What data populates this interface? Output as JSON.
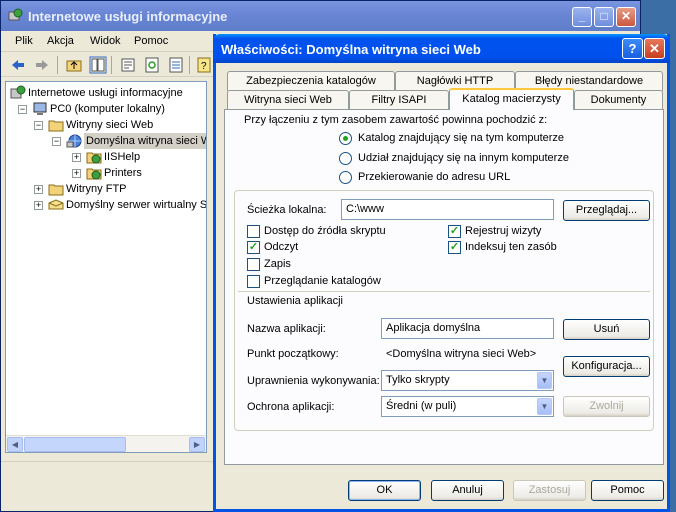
{
  "iis": {
    "title": "Internetowe usługi informacyjne",
    "menu": [
      "Plik",
      "Akcja",
      "Widok",
      "Pomoc"
    ],
    "tree": {
      "root": "Internetowe usługi informacyjne",
      "computer": "PC0 (komputer lokalny)",
      "web_sites": "Witryny sieci Web",
      "default_site": "Domyślna witryna sieci Web",
      "iishelp": "IISHelp",
      "printers": "Printers",
      "ftp_sites": "Witryny FTP",
      "smtp": "Domyślny serwer wirtualny SMTP"
    }
  },
  "dialog": {
    "title": "Właściwości: Domyślna witryna sieci Web",
    "tabs_back": [
      "Zabezpieczenia katalogów",
      "Nagłówki HTTP",
      "Błędy niestandardowe"
    ],
    "tabs_front": [
      "Witryna sieci Web",
      "Filtry ISAPI",
      "Katalog macierzysty",
      "Dokumenty"
    ],
    "active_tab": "Katalog macierzysty",
    "source_prompt": "Przy łączeniu z tym zasobem zawartość powinna pochodzić z:",
    "source_options": [
      {
        "label": "Katalog znajdujący się na tym komputerze",
        "selected": true
      },
      {
        "label": "Udział znajdujący się na innym komputerze",
        "selected": false
      },
      {
        "label": "Przekierowanie do adresu URL",
        "selected": false
      }
    ],
    "local_path_label": "Ścieżka lokalna:",
    "local_path_value": "C:\\www",
    "browse_button": "Przeglądaj...",
    "permissions": {
      "script_source": {
        "label": "Dostęp do źródła skryptu",
        "checked": false
      },
      "read": {
        "label": "Odczyt",
        "checked": true
      },
      "write": {
        "label": "Zapis",
        "checked": false
      },
      "browse": {
        "label": "Przeglądanie katalogów",
        "checked": false
      },
      "log_visits": {
        "label": "Rejestruj wizyty",
        "checked": true
      },
      "index": {
        "label": "Indeksuj ten zasób",
        "checked": true
      }
    },
    "app_settings_heading": "Ustawienia aplikacji",
    "app_name_label": "Nazwa aplikacji:",
    "app_name_value": "Aplikacja domyślna",
    "remove_button": "Usuń",
    "start_point_label": "Punkt początkowy:",
    "start_point_value": "<Domyślna witryna sieci Web>",
    "config_button": "Konfiguracja...",
    "exec_perm_label": "Uprawnienia wykonywania:",
    "exec_perm_value": "Tylko skrypty",
    "protection_label": "Ochrona aplikacji:",
    "protection_value": "Średni (w puli)",
    "unload_button": "Zwolnij",
    "footer_buttons": {
      "ok": "OK",
      "cancel": "Anuluj",
      "apply": "Zastosuj",
      "help": "Pomoc"
    }
  }
}
